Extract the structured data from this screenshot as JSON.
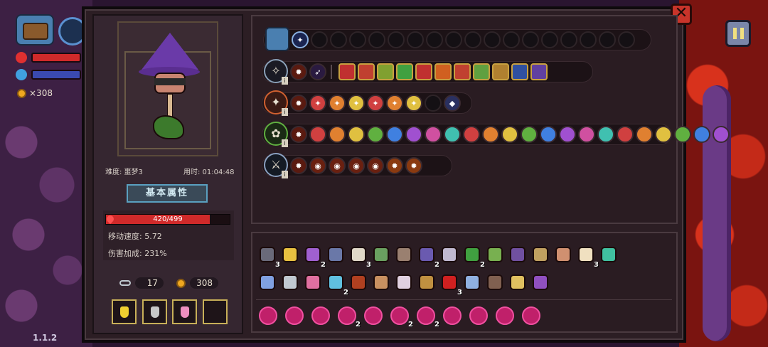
{
  "hud": {
    "gold_display": "×308",
    "version": "1.1.2"
  },
  "character": {
    "difficulty_label": "难度: 噩梦3",
    "time_label": "用时: 01:04:48",
    "attributes_title": "基本属性",
    "hp_text": "420/499",
    "hp_current": 420,
    "hp_max": 499,
    "move_speed": "移动速度: 5.72",
    "damage_bonus": "伤害加成: 231%",
    "keys": "17",
    "gold": "308",
    "potions": [
      "yellow-potion",
      "grey-jar",
      "pink-potion",
      "empty"
    ]
  },
  "weapon_rows": [
    {
      "name": "chest-row",
      "slots": 19,
      "filled": [
        "chest",
        "star"
      ]
    },
    {
      "name": "spellbook-row",
      "gems": 2,
      "runes": 11
    },
    {
      "name": "fire-staff-row",
      "gems": 2,
      "runes": 6,
      "empty": 1,
      "extra": 1
    },
    {
      "name": "nature-staff-row",
      "gems": 2,
      "runes": 22
    },
    {
      "name": "sword-row",
      "gems": 2,
      "runes": 6
    }
  ],
  "inventory": {
    "row1": [
      {
        "icon": "hat-icon",
        "count": "3",
        "color": "#6a6a7a"
      },
      {
        "icon": "crystal-icon",
        "count": "",
        "color": "#e8c040"
      },
      {
        "icon": "boot-icon",
        "count": "2",
        "color": "#a060d0"
      },
      {
        "icon": "gauntlet-icon",
        "count": "",
        "color": "#6a78a8"
      },
      {
        "icon": "jaw-icon",
        "count": "3",
        "color": "#e0d8c8"
      },
      {
        "icon": "shoe-icon",
        "count": "",
        "color": "#6aa060"
      },
      {
        "icon": "scythe-icon",
        "count": "",
        "color": "#9a8070"
      },
      {
        "icon": "bag-icon",
        "count": "2",
        "color": "#6a5ab0"
      },
      {
        "icon": "scroll-icon",
        "count": "",
        "color": "#c0b8d0"
      },
      {
        "icon": "leaf-icon",
        "count": "2",
        "color": "#40a040"
      },
      {
        "icon": "clover-icon",
        "count": "",
        "color": "#78b050"
      },
      {
        "icon": "cloak-icon",
        "count": "",
        "color": "#7050a0"
      },
      {
        "icon": "branch-icon",
        "count": "",
        "color": "#c0a060"
      },
      {
        "icon": "shield-icon",
        "count": "",
        "color": "#d09070"
      },
      {
        "icon": "feather-icon",
        "count": "3",
        "color": "#f0e0c0"
      },
      {
        "icon": "wing-icon",
        "count": "",
        "color": "#40c0a0"
      }
    ],
    "row2": [
      {
        "icon": "gem-icon",
        "count": "",
        "color": "#80a0e0"
      },
      {
        "icon": "sword-icon",
        "count": "",
        "color": "#c0c8d0"
      },
      {
        "icon": "radish-icon",
        "count": "",
        "color": "#e070a0"
      },
      {
        "icon": "slime-icon",
        "count": "2",
        "color": "#60c0e0"
      },
      {
        "icon": "cage-icon",
        "count": "",
        "color": "#b04020"
      },
      {
        "icon": "book-icon",
        "count": "",
        "color": "#c89060"
      },
      {
        "icon": "bird-icon",
        "count": "",
        "color": "#e0d0e0"
      },
      {
        "icon": "pickaxe-icon",
        "count": "",
        "color": "#c09040"
      },
      {
        "icon": "eye-icon",
        "count": "3",
        "color": "#d02020"
      },
      {
        "icon": "mirror-icon",
        "count": "",
        "color": "#90b0e0"
      },
      {
        "icon": "armor-icon",
        "count": "",
        "color": "#806050"
      },
      {
        "icon": "antler-icon",
        "count": "",
        "color": "#e0c060"
      },
      {
        "icon": "witch-hat-icon",
        "count": "",
        "color": "#9050c0"
      }
    ],
    "runes": [
      {
        "count": ""
      },
      {
        "count": ""
      },
      {
        "count": ""
      },
      {
        "count": "2"
      },
      {
        "count": ""
      },
      {
        "count": "2"
      },
      {
        "count": "2"
      },
      {
        "count": ""
      },
      {
        "count": ""
      },
      {
        "count": ""
      },
      {
        "count": ""
      }
    ]
  }
}
